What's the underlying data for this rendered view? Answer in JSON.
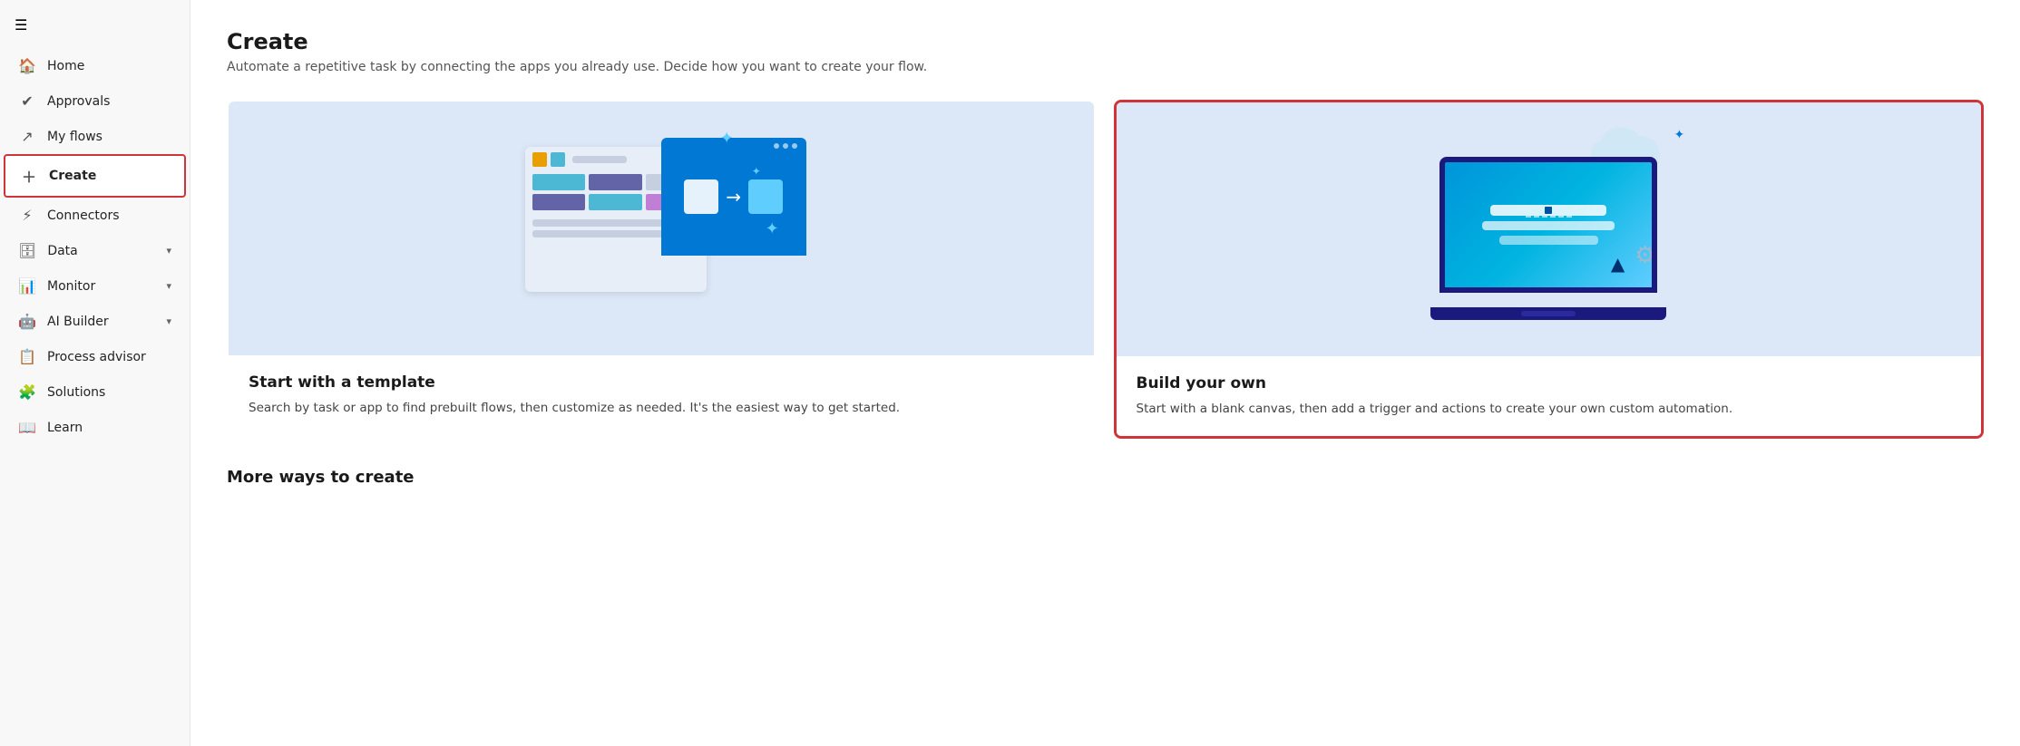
{
  "sidebar": {
    "hamburger_label": "☰",
    "items": [
      {
        "id": "home",
        "label": "Home",
        "icon": "🏠",
        "active": false,
        "has_chevron": false
      },
      {
        "id": "approvals",
        "label": "Approvals",
        "icon": "✓",
        "active": false,
        "has_chevron": false
      },
      {
        "id": "my-flows",
        "label": "My flows",
        "icon": "↗",
        "active": false,
        "has_chevron": false
      },
      {
        "id": "create",
        "label": "Create",
        "icon": "+",
        "active": true,
        "has_chevron": false
      },
      {
        "id": "connectors",
        "label": "Connectors",
        "icon": "⚡",
        "active": false,
        "has_chevron": false
      },
      {
        "id": "data",
        "label": "Data",
        "icon": "🗄",
        "active": false,
        "has_chevron": true
      },
      {
        "id": "monitor",
        "label": "Monitor",
        "icon": "📊",
        "active": false,
        "has_chevron": true
      },
      {
        "id": "ai-builder",
        "label": "AI Builder",
        "icon": "🤖",
        "active": false,
        "has_chevron": true
      },
      {
        "id": "process-advisor",
        "label": "Process advisor",
        "icon": "📋",
        "active": false,
        "has_chevron": false
      },
      {
        "id": "solutions",
        "label": "Solutions",
        "icon": "🧩",
        "active": false,
        "has_chevron": false
      },
      {
        "id": "learn",
        "label": "Learn",
        "icon": "📖",
        "active": false,
        "has_chevron": false
      }
    ]
  },
  "main": {
    "title": "Create",
    "subtitle": "Automate a repetitive task by connecting the apps you already use. Decide how you want to create your flow.",
    "cards": [
      {
        "id": "template",
        "title": "Start with a template",
        "description": "Search by task or app to find prebuilt flows, then customize as needed. It's the easiest way to get started.",
        "selected": false
      },
      {
        "id": "build-own",
        "title": "Build your own",
        "description": "Start with a blank canvas, then add a trigger and actions to create your own custom automation.",
        "selected": true
      }
    ],
    "more_ways_title": "More ways to create"
  }
}
